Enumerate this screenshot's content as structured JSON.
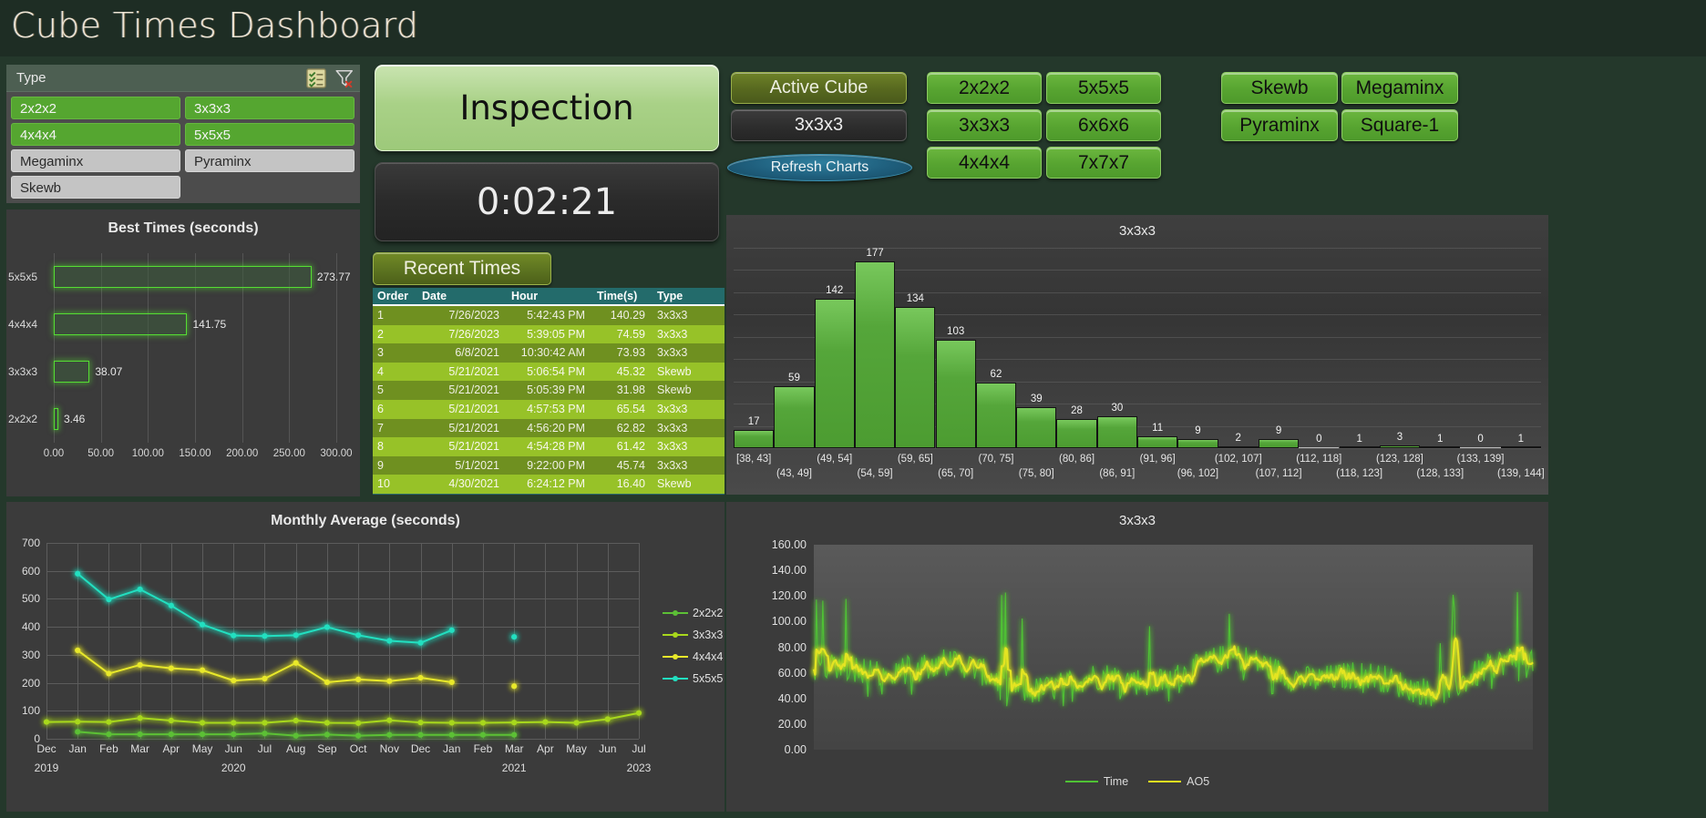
{
  "header": {
    "title": "Cube Times Dashboard"
  },
  "slicer": {
    "label": "Type",
    "icons": [
      "multi-select-icon",
      "clear-filter-icon"
    ],
    "items": [
      {
        "label": "2x2x2",
        "selected": true
      },
      {
        "label": "3x3x3",
        "selected": true
      },
      {
        "label": "4x4x4",
        "selected": true
      },
      {
        "label": "5x5x5",
        "selected": true
      },
      {
        "label": "Megaminx",
        "selected": false
      },
      {
        "label": "Pyraminx",
        "selected": false
      },
      {
        "label": "Skewb",
        "selected": false
      }
    ]
  },
  "timer": {
    "state_label": "Inspection",
    "value": "0:02:21",
    "recent_times_label": "Recent Times"
  },
  "active_cube": {
    "label": "Active Cube",
    "value": "3x3x3",
    "refresh_label": "Refresh Charts"
  },
  "cube_buttons_left": [
    "2x2x2",
    "3x3x3",
    "4x4x4"
  ],
  "cube_buttons_mid": [
    "5x5x5",
    "6x6x6",
    "7x7x7"
  ],
  "cube_buttons_right": [
    "Skewb",
    "Megaminx",
    "Pyraminx",
    "Square-1"
  ],
  "recent_times": {
    "columns": [
      "Order",
      "Date",
      "Hour",
      "Time(s)",
      "Type"
    ],
    "rows": [
      [
        "1",
        "7/26/2023",
        "5:42:43 PM",
        "140.29",
        "3x3x3"
      ],
      [
        "2",
        "7/26/2023",
        "5:39:05 PM",
        "74.59",
        "3x3x3"
      ],
      [
        "3",
        "6/8/2021",
        "10:30:42 AM",
        "73.93",
        "3x3x3"
      ],
      [
        "4",
        "5/21/2021",
        "5:06:54 PM",
        "45.32",
        "Skewb"
      ],
      [
        "5",
        "5/21/2021",
        "5:05:39 PM",
        "31.98",
        "Skewb"
      ],
      [
        "6",
        "5/21/2021",
        "4:57:53 PM",
        "65.54",
        "3x3x3"
      ],
      [
        "7",
        "5/21/2021",
        "4:56:20 PM",
        "62.82",
        "3x3x3"
      ],
      [
        "8",
        "5/21/2021",
        "4:54:28 PM",
        "61.42",
        "3x3x3"
      ],
      [
        "9",
        "5/1/2021",
        "9:22:00 PM",
        "45.74",
        "3x3x3"
      ],
      [
        "10",
        "4/30/2021",
        "6:24:12 PM",
        "16.40",
        "Skewb"
      ]
    ]
  },
  "chart_data": [
    {
      "id": "best_times",
      "type": "bar",
      "orientation": "horizontal",
      "title": "Best Times (seconds)",
      "xlabel": "",
      "ylabel": "",
      "categories": [
        "5x5x5",
        "4x4x4",
        "3x3x3",
        "2x2x2"
      ],
      "values": [
        273.77,
        141.75,
        38.07,
        3.46
      ],
      "value_labels": [
        "273.77",
        "141.75",
        "38.07",
        "3.46"
      ],
      "xlim": [
        0,
        300
      ],
      "xticks": [
        "0.00",
        "50.00",
        "100.00",
        "150.00",
        "200.00",
        "250.00",
        "300.00"
      ],
      "grid": true,
      "accent": "#55dd33"
    },
    {
      "id": "histogram_3x3x3",
      "type": "bar",
      "title": "3x3x3",
      "xlabel": "",
      "ylabel": "",
      "categories": [
        "[38, 43]",
        "(43, 49]",
        "(49, 54]",
        "(54, 59]",
        "(59, 65]",
        "(65, 70]",
        "(70, 75]",
        "(75, 80]",
        "(80, 86]",
        "(86, 91]",
        "(91, 96]",
        "(96, 102]",
        "(102, 107]",
        "(107, 112]",
        "(112, 118]",
        "(118, 123]",
        "(123, 128]",
        "(128, 133]",
        "(133, 139]",
        "(139, 144]"
      ],
      "values": [
        17,
        59,
        142,
        177,
        134,
        103,
        62,
        39,
        28,
        30,
        11,
        9,
        2,
        9,
        0,
        1,
        3,
        1,
        0,
        1
      ],
      "ylim": [
        0,
        190
      ],
      "grid": true,
      "accent": "#55a63a"
    },
    {
      "id": "monthly_average",
      "type": "line",
      "title": "Monthly Average (seconds)",
      "xlabel": "",
      "ylabel": "",
      "ylim": [
        0,
        700
      ],
      "yticks": [
        0,
        100,
        200,
        300,
        400,
        500,
        600,
        700
      ],
      "categories": [
        "Dec",
        "Jan",
        "Feb",
        "Mar",
        "Apr",
        "May",
        "Jun",
        "Jul",
        "Aug",
        "Sep",
        "Oct",
        "Nov",
        "Dec",
        "Jan",
        "Feb",
        "Mar",
        "Apr",
        "May",
        "Jun",
        "Jul"
      ],
      "year_labels": [
        {
          "label": "2019",
          "index": 0
        },
        {
          "label": "2020",
          "index": 6
        },
        {
          "label": "2021",
          "index": 15
        },
        {
          "label": "2023",
          "index": 19
        }
      ],
      "legend_position": "right",
      "series": [
        {
          "name": "2x2x2",
          "color": "#5cc036",
          "values": [
            null,
            25,
            16,
            16,
            16,
            16,
            16,
            19,
            11,
            15,
            11,
            14,
            14,
            14,
            14,
            14,
            null,
            null,
            null,
            null
          ]
        },
        {
          "name": "3x3x3",
          "color": "#a8d81c",
          "values": [
            60,
            61,
            60,
            74,
            65,
            57,
            57,
            57,
            65,
            57,
            56,
            66,
            58,
            57,
            57,
            58,
            60,
            57,
            70,
            92
          ]
        },
        {
          "name": "4x4x4",
          "color": "#e8e82a",
          "values": [
            null,
            316,
            233,
            264,
            252,
            245,
            208,
            215,
            271,
            202,
            212,
            206,
            218,
            202,
            null,
            188,
            null,
            null,
            null,
            null
          ]
        },
        {
          "name": "5x5x5",
          "color": "#22dfc0",
          "values": [
            null,
            590,
            498,
            534,
            476,
            408,
            369,
            367,
            370,
            399,
            370,
            350,
            343,
            388,
            null,
            364,
            null,
            null,
            null,
            null
          ]
        }
      ]
    },
    {
      "id": "timeseries_3x3x3",
      "type": "line",
      "title": "3x3x3",
      "xlabel": "",
      "ylabel": "",
      "ylim": [
        0,
        160
      ],
      "yticks": [
        "0.00",
        "20.00",
        "40.00",
        "60.00",
        "80.00",
        "100.00",
        "120.00",
        "140.00",
        "160.00"
      ],
      "legend_position": "bottom",
      "series": [
        {
          "name": "Time",
          "color": "#4fc234"
        },
        {
          "name": "AO5",
          "color": "#e4e420"
        }
      ]
    }
  ]
}
